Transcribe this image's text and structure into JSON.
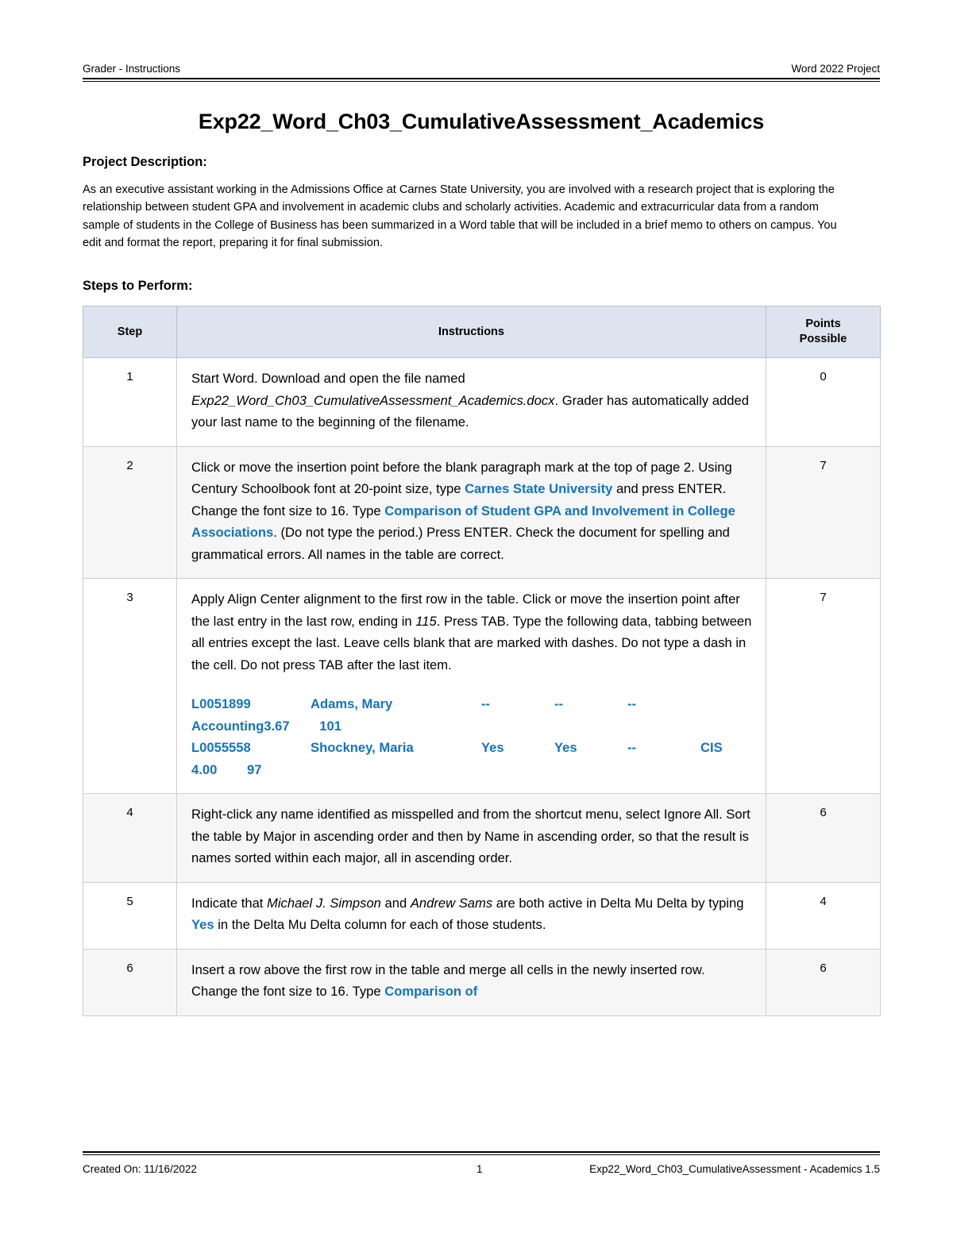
{
  "header": {
    "left": "Grader - Instructions",
    "right": "Word 2022 Project"
  },
  "title": "Exp22_Word_Ch03_CumulativeAssessment_Academics",
  "project_description": {
    "heading": "Project Description:",
    "body": "As an executive assistant working in the Admissions Office at Carnes State University, you are involved with a research project that is exploring the relationship between student GPA and involvement in academic clubs and scholarly activities. Academic and extracurricular data from a random sample of students in the College of Business has been summarized in a Word table that will be included in a brief memo to others on campus. You edit and format the report, preparing it for final submission."
  },
  "steps_section": {
    "heading": "Steps to Perform:"
  },
  "table": {
    "columns": [
      "Step",
      "Instructions",
      "Points\nPossible"
    ],
    "column_labels": {
      "step": "Step",
      "instructions": "Instructions",
      "points_line1": "Points",
      "points_line2": "Possible"
    },
    "accent_color": "#1274c3",
    "header_bg": "#dde4ef",
    "alt_row_bg": "#f6f6f6",
    "rows": [
      {
        "step": "1",
        "points": "0",
        "text_plain": "Start Word. Download and open the file named Exp22_Word_Ch03_CumulativeAssessment_Academics.docx. Grader has automatically added your last name to the beginning of the filename.",
        "segments": [
          {
            "t": "Start Word. Download and open the file named "
          },
          {
            "t": "Exp22_Word_Ch03_CumulativeAssessment_Academics.docx",
            "style": "italic"
          },
          {
            "t": ". Grader has automatically added your last name to the beginning of the filename."
          }
        ]
      },
      {
        "step": "2",
        "points": "7",
        "text_plain": "Click or move the insertion point before the blank paragraph mark at the top of page 2. Using Century Schoolbook font at 20-point size, type Carnes State University and press ENTER. Change the font size to 16. Type Comparison of Student GPA and Involvement in College Associations. (Do not type the period.) Press ENTER. Check the document for spelling and grammatical errors. All names in the table are correct.",
        "segments": [
          {
            "t": "Click or move the insertion point before the blank paragraph mark at the top of page 2. Using Century Schoolbook font at 20-point size, type "
          },
          {
            "t": "Carnes State University",
            "style": "highlight"
          },
          {
            "t": " and press ENTER. Change the font size to 16. Type "
          },
          {
            "t": "Comparison of Student GPA and Involvement in College Associations",
            "style": "highlight"
          },
          {
            "t": ". (Do not type the period.) Press ENTER. Check the document for spelling and grammatical errors. All names in the table are correct."
          }
        ]
      },
      {
        "step": "3",
        "points": "7",
        "text_plain": "Apply Align Center alignment to the first row in the table. Click or move the insertion point after the last entry in the last row, ending in 115. Press TAB. Type the following data, tabbing between all entries except the last. Leave cells blank that are marked with dashes. Do not type a dash in the cell. Do not press TAB after the last item.",
        "segments": [
          {
            "t": "Apply Align Center alignment to the first row in the table. Click or move the insertion point after the last entry in the last row, ending in "
          },
          {
            "t": "115",
            "style": "italic"
          },
          {
            "t": ". Press TAB. Type the following data, tabbing between all entries except the last. Leave cells blank that are marked with dashes. Do not type a dash in the cell. Do not press TAB after the last item."
          }
        ],
        "data_lines": [
          "L0051899\tAdams, Mary\t--\t--\t--\tAccounting\t3.67\t101",
          "L0055558\tShockney, Maria\tYes\tYes\t--\tCIS\t4.00\t97"
        ],
        "data_records": [
          {
            "id": "L0051899",
            "name": "Adams, Mary",
            "col3": "--",
            "col4": "--",
            "col5": "--",
            "major": "Accounting",
            "gpa": "3.67",
            "hours": "101"
          },
          {
            "id": "L0055558",
            "name": "Shockney, Maria",
            "col3": "Yes",
            "col4": "Yes",
            "col5": "--",
            "major": "CIS",
            "gpa": "4.00",
            "hours": "97"
          }
        ]
      },
      {
        "step": "4",
        "points": "6",
        "text_plain": "Right-click any name identified as misspelled and from the shortcut menu, select Ignore All. Sort the table by Major in ascending order and then by Name in ascending order, so that the result is names sorted within each major, all in ascending order.",
        "segments": [
          {
            "t": "Right-click any name identified as misspelled and from the shortcut menu, select Ignore All. Sort the table by Major in ascending order and then by Name in ascending order, so that the result is names sorted within each major, all in ascending order."
          }
        ]
      },
      {
        "step": "5",
        "points": "4",
        "text_plain": "Indicate that Michael J. Simpson and Andrew Sams are both active in Delta Mu Delta by typing Yes in the Delta Mu Delta column for each of those students.",
        "segments": [
          {
            "t": "Indicate that "
          },
          {
            "t": "Michael J. Simpson",
            "style": "italic"
          },
          {
            "t": " and "
          },
          {
            "t": "Andrew Sams",
            "style": "italic"
          },
          {
            "t": " are both active in Delta Mu Delta by typing "
          },
          {
            "t": "Yes",
            "style": "highlight"
          },
          {
            "t": " in the Delta Mu Delta column for each of those students."
          }
        ]
      },
      {
        "step": "6",
        "points": "6",
        "text_plain": "Insert a row above the first row in the table and merge all cells in the newly inserted row. Change the font size to 16. Type Comparison of",
        "segments": [
          {
            "t": "Insert a row above the first row in the table and merge all cells in the newly inserted row. Change the font size to 16. Type "
          },
          {
            "t": "Comparison of",
            "style": "highlight"
          }
        ]
      }
    ]
  },
  "footer": {
    "created_on": "Created On: 11/16/2022",
    "page_number": "1",
    "document_ref": "Exp22_Word_Ch03_CumulativeAssessment - Academics 1.5"
  }
}
